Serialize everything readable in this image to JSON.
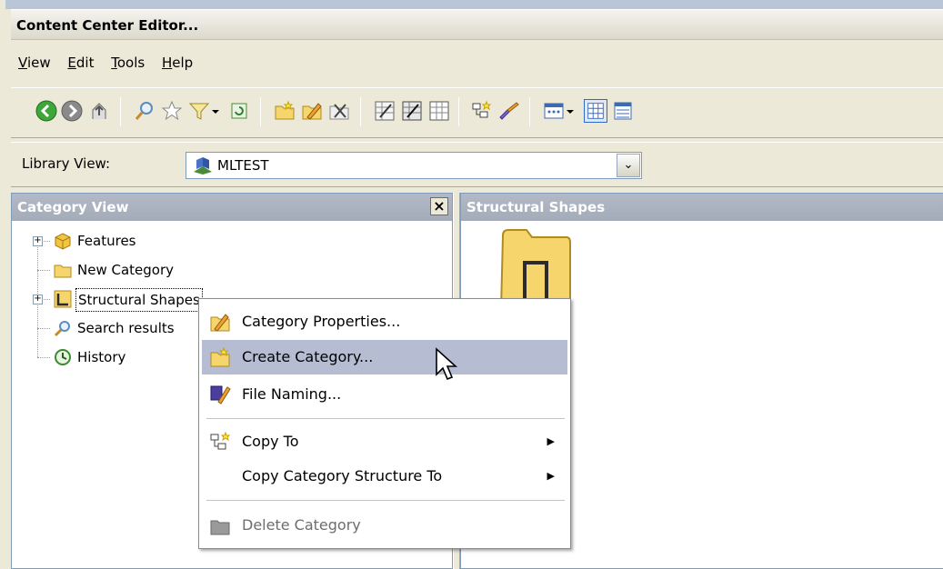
{
  "window": {
    "title": "Content Center Editor..."
  },
  "menubar": {
    "items": [
      {
        "pre": "",
        "ul": "V",
        "post": "iew"
      },
      {
        "pre": "",
        "ul": "E",
        "post": "dit"
      },
      {
        "pre": "",
        "ul": "T",
        "post": "ools"
      },
      {
        "pre": "",
        "ul": "H",
        "post": "elp"
      }
    ]
  },
  "toolbar": {
    "icons": [
      "back-icon",
      "forward-icon",
      "up-folder-icon",
      "search-icon",
      "favorites-icon",
      "filter-icon",
      "filter-dropdown-icon",
      "refresh-icon",
      "new-category-icon",
      "category-properties-icon",
      "delete-icon",
      "edit-table-icon",
      "edit-table-2-icon",
      "table-view-icon",
      "copy-to-icon",
      "file-naming-icon",
      "view-options-icon",
      "view-dropdown-icon",
      "detail-view-icon",
      "list-view-icon"
    ]
  },
  "library": {
    "label": "Library View:",
    "value": "MLTEST"
  },
  "category_panel": {
    "title": "Category View",
    "tree": [
      {
        "label": "Features"
      },
      {
        "label": "New Category"
      },
      {
        "label": "Structural Shapes"
      },
      {
        "label": "Search results"
      },
      {
        "label": "History"
      }
    ]
  },
  "shapes_panel": {
    "title": "Structural Shapes"
  },
  "context_menu": {
    "items": [
      {
        "label": "Category Properties..."
      },
      {
        "label": "Create Category..."
      },
      {
        "label": "File Naming..."
      },
      {
        "label": "Copy To"
      },
      {
        "label": "Copy Category Structure To"
      },
      {
        "label": "Delete Category"
      }
    ]
  },
  "colors": {
    "panel_header": "#a9afbd",
    "highlight": "#b6bdd2",
    "window_bg": "#ece9d8"
  }
}
